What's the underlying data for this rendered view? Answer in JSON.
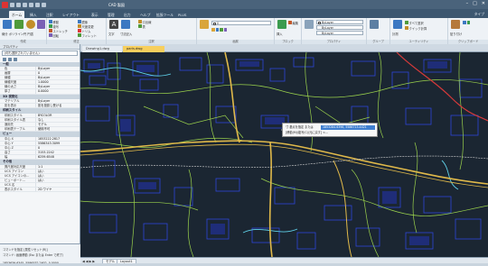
{
  "app": {
    "title": "CAD 製図"
  },
  "window": {
    "minimize": "–",
    "maximize": "□",
    "close": "✕"
  },
  "ribbon_tabs": [
    "ホーム",
    "挿入",
    "注釈",
    "レイアウト",
    "表示",
    "管理",
    "出力",
    "ヘルプ",
    "拡張ツール",
    "PLUS"
  ],
  "ribbon_tabs_right": "タイプ",
  "ribbon": {
    "groups": [
      "作成",
      "修正",
      "注釈",
      "画層",
      "ブロック",
      "プロパティ",
      "グループ",
      "ユーティリティ",
      "クリップボード"
    ],
    "draw": {
      "line": "線分",
      "polyline": "ポリライン",
      "circle": "円",
      "arc": "円弧"
    },
    "modify": {
      "move": "移動",
      "copy": "複写",
      "stretch": "ストレッチ",
      "rotate": "回転",
      "mirror": "鏡像",
      "scale": "尺度変更",
      "trim": "トリム",
      "fillet": "フィレット"
    },
    "annotation": {
      "text": "文字",
      "dimension": "寸法記入",
      "leader": "引出線",
      "table": "表"
    },
    "layer_dropdown": "0",
    "block": {
      "insert": "挿入",
      "edit": "編集"
    },
    "props": {
      "color": "ByLayer",
      "linetype": "ByLayer",
      "lineweight": "ByLayer"
    },
    "utilities": {
      "measure": "計測",
      "select": "すべて選択",
      "calc": "クイック計算"
    },
    "clipboard": {
      "paste": "貼り付け"
    }
  },
  "properties_panel": {
    "title": "プロパティ",
    "selection": "(何も選択されていません)",
    "sections": [
      {
        "name": "一般",
        "rows": [
          {
            "key": "色",
            "value": "ByLayer"
          },
          {
            "key": "画層",
            "value": "0"
          },
          {
            "key": "線種",
            "value": "ByLayer"
          },
          {
            "key": "線種尺度",
            "value": "1.0000"
          },
          {
            "key": "線の太さ",
            "value": "ByLayer"
          },
          {
            "key": "厚さ",
            "value": "0.0000"
          }
        ]
      },
      {
        "name": "3D 視覚化",
        "rows": [
          {
            "key": "マテリアル",
            "value": "ByLayer"
          },
          {
            "key": "影を表示",
            "value": "影を投影し受ける"
          }
        ]
      },
      {
        "name": "印刷スタイル",
        "rows": [
          {
            "key": "印刷スタイル",
            "value": "BYCOLOR"
          },
          {
            "key": "印刷スタイル表",
            "value": "なし"
          },
          {
            "key": "適用先",
            "value": "モデル"
          },
          {
            "key": "印刷表テーブル",
            "value": "使用不可"
          }
        ]
      },
      {
        "name": "ビュー",
        "rows": [
          {
            "key": "中心 X",
            "value": "1853222.2817"
          },
          {
            "key": "中心 Y",
            "value": "5586343.3099"
          },
          {
            "key": "中心 Z",
            "value": "0"
          },
          {
            "key": "高さ",
            "value": "3153.2242"
          },
          {
            "key": "幅",
            "value": "6259.6548"
          }
        ]
      },
      {
        "name": "その他",
        "rows": [
          {
            "key": "異尺度対応尺度",
            "value": "1:1"
          },
          {
            "key": "UCS アイコン",
            "value": "はい"
          },
          {
            "key": "UCS アイコンの…",
            "value": "はい"
          },
          {
            "key": "ビューポート…",
            "value": "はい"
          },
          {
            "key": "UCS 名",
            "value": ""
          },
          {
            "key": "表示スタイル",
            "value": "2D ワイヤ"
          }
        ]
      }
    ]
  },
  "doc_tabs": [
    "Drawing1.dwg",
    "paris.dwg"
  ],
  "active_doc_tab": 1,
  "tooltip": {
    "line1": "寸 基点を指定 または",
    "line2": "[移動(M)/複写(C)/元に戻す] <…",
    "highlight": "1853284.6396, 5586713.4421"
  },
  "layout_tabs": {
    "nav": "◀ ◀ ▶ ▶",
    "tabs": [
      "モデル",
      "Layout1"
    ]
  },
  "status": {
    "line1": "コマンドを指定 [属性リセット(R)]",
    "line2": "コマンド: 画面移動 (Esc または Enter で終了)",
    "coords": "1853639.6345, 5586532.2602, 0.0000"
  },
  "colors": {
    "canvas_bg": "#1b2632",
    "road_major": "#e0b94a",
    "road_minor": "#9ad14c",
    "buildings": "#2c46d6",
    "rail": "#d4d4d4",
    "water": "#5fd0e8",
    "red_road": "#d73a3a"
  }
}
